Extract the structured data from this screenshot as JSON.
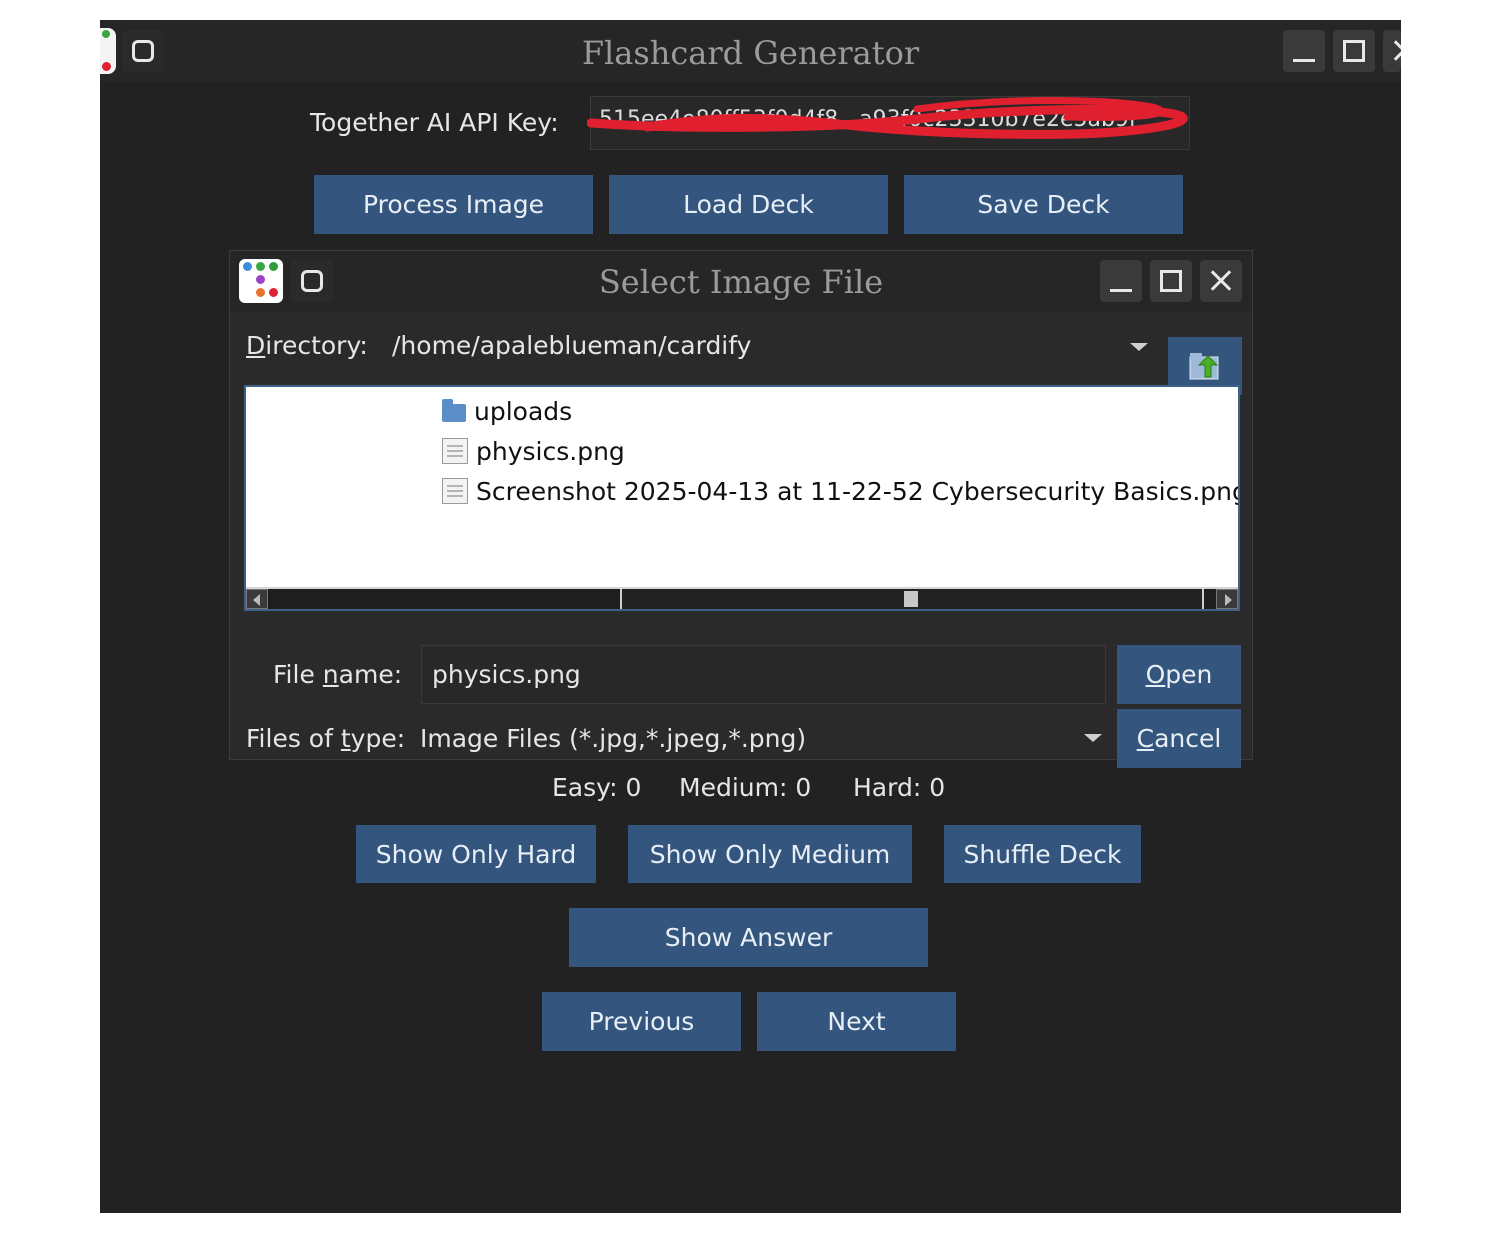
{
  "main_window": {
    "title": "Flashcard Generator",
    "api_key_label": "Together AI API Key:",
    "api_key_value": "515ee4e80ff53f0d4f8...a93f0c23310b7e2e5ab9f",
    "buttons": {
      "process_image": "Process Image",
      "load_deck": "Load Deck",
      "save_deck": "Save Deck",
      "show_only_hard": "Show Only Hard",
      "show_only_medium": "Show Only Medium",
      "shuffle_deck": "Shuffle Deck",
      "show_answer": "Show Answer",
      "previous": "Previous",
      "next": "Next"
    },
    "stats": {
      "easy": "Easy: 0",
      "medium": "Medium: 0",
      "hard": "Hard: 0"
    }
  },
  "dialog": {
    "title": "Select Image File",
    "directory_label_prefix": "D",
    "directory_label_rest": "irectory:",
    "directory_value": "/home/apaleblueman/cardify",
    "files": [
      {
        "name": "uploads",
        "icon": "folder-icon"
      },
      {
        "name": "physics.png",
        "icon": "file-icon"
      },
      {
        "name": "Screenshot 2025-04-13 at 11-22-52 Cybersecurity Basics.png",
        "icon": "file-icon"
      }
    ],
    "file_name_label_a": "File ",
    "file_name_label_u": "n",
    "file_name_label_b": "ame:",
    "file_name_value": "physics.png",
    "files_of_type_label_a": "Files of ",
    "files_of_type_label_u": "t",
    "files_of_type_label_b": "ype:",
    "files_of_type_value": "Image Files (*.jpg,*.jpeg,*.png)",
    "open_u": "O",
    "open_rest": "pen",
    "cancel_u": "C",
    "cancel_rest": "ancel"
  },
  "colors": {
    "window_bg": "#222222",
    "button_bg": "#34567e",
    "list_border": "#3e6187",
    "redaction": "#e0202f"
  }
}
